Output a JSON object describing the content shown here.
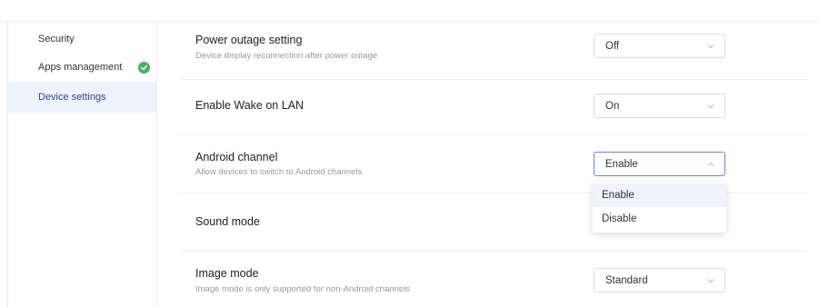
{
  "sidebar": {
    "items": [
      {
        "label": "Security"
      },
      {
        "label": "Apps management",
        "status_icon": "check-circle-icon",
        "status_color": "#4caf66"
      },
      {
        "label": "Device settings",
        "active": true
      }
    ]
  },
  "settings": [
    {
      "title": "Power outage setting",
      "description": "Device display reconnection after power outage",
      "value": "Off"
    },
    {
      "title": "Enable Wake on LAN",
      "value": "On"
    },
    {
      "title": "Android channel",
      "description": "Allow devices to switch to Android channels",
      "value": "Enable",
      "open": true
    },
    {
      "title": "Sound mode"
    },
    {
      "title": "Image mode",
      "description": "Image mode is only supported for non-Android channels",
      "value": "Standard"
    }
  ],
  "dropdown": {
    "options": [
      "Enable",
      "Disable"
    ],
    "selected": "Enable"
  },
  "colors": {
    "accent": "#6b86c9",
    "active_bg": "#eef2fb"
  }
}
